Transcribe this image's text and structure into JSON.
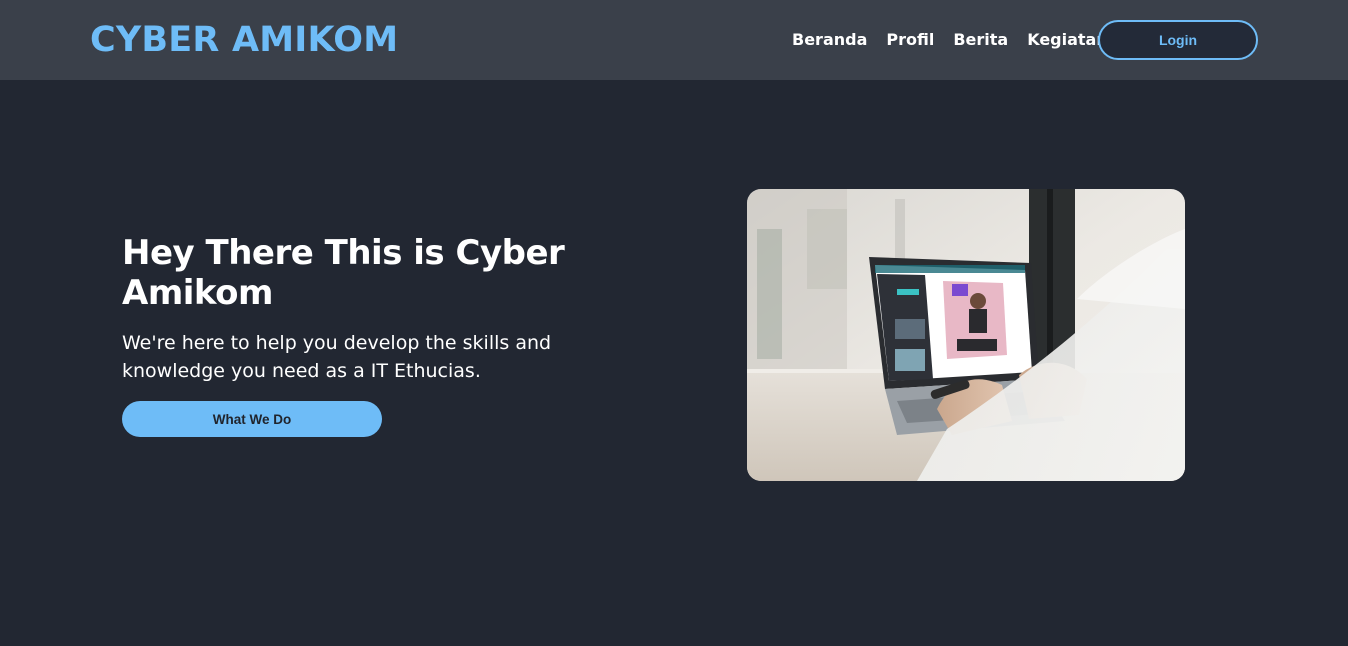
{
  "header": {
    "brand": "CYBER AMIKOM",
    "nav": [
      {
        "label": "Beranda"
      },
      {
        "label": "Profil"
      },
      {
        "label": "Berita"
      },
      {
        "label": "Kegiatan"
      }
    ],
    "login_label": "Login"
  },
  "hero": {
    "title": "Hey There This is Cyber Amikom",
    "subtitle": "We're here to help you develop the skills and knowledge you need as a IT Ethucias.",
    "cta_label": "What We Do",
    "image_icon": "laptop-photo"
  },
  "colors": {
    "accent": "#6ebcf7",
    "navbar_bg": "#3a404a",
    "page_bg": "#222732"
  }
}
